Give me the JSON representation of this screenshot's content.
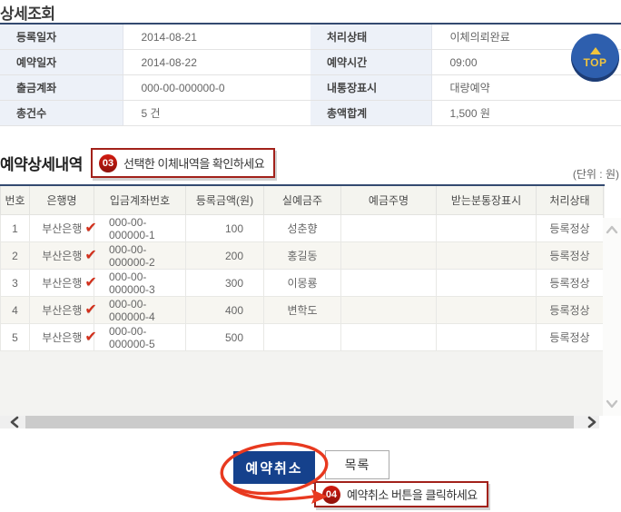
{
  "page": {
    "title": "상세조회",
    "section_title": "예약상세내역",
    "unit_note": "(단위 : 원)"
  },
  "top_button": {
    "label": "TOP"
  },
  "summary": {
    "rows": [
      {
        "label1": "등록일자",
        "value1": "2014-08-21",
        "label2": "처리상태",
        "value2": "이체의뢰완료"
      },
      {
        "label1": "예약일자",
        "value1": "2014-08-22",
        "label2": "예약시간",
        "value2": "09:00"
      },
      {
        "label1": "출금계좌",
        "value1": "000-00-000000-0",
        "label2": "내통장표시",
        "value2": "대량예약"
      },
      {
        "label1": "총건수",
        "value1": "5 건",
        "label2": "총액합계",
        "value2": "1,500 원"
      }
    ]
  },
  "callouts": {
    "step3": {
      "num": "03",
      "msg": "선택한 이체내역을 확인하세요"
    },
    "step4": {
      "num": "04",
      "msg": "예약취소 버튼을 클릭하세요"
    }
  },
  "detail_table": {
    "headers": [
      "번호",
      "은행명",
      "입금계좌번호",
      "등록금액(원)",
      "실예금주",
      "예금주명",
      "받는분통장표시",
      "처리상태"
    ],
    "check_icon": "✔",
    "rows": [
      {
        "no": "1",
        "bank": "부산은행",
        "account": "000-00-000000-1",
        "amount": "100",
        "holder": "성춘향",
        "depositor": "",
        "passbook": "",
        "status": "등록정상"
      },
      {
        "no": "2",
        "bank": "부산은행",
        "account": "000-00-000000-2",
        "amount": "200",
        "holder": "홍길동",
        "depositor": "",
        "passbook": "",
        "status": "등록정상"
      },
      {
        "no": "3",
        "bank": "부산은행",
        "account": "000-00-000000-3",
        "amount": "300",
        "holder": "이몽룡",
        "depositor": "",
        "passbook": "",
        "status": "등록정상"
      },
      {
        "no": "4",
        "bank": "부산은행",
        "account": "000-00-000000-4",
        "amount": "400",
        "holder": "변학도",
        "depositor": "",
        "passbook": "",
        "status": "등록정상"
      },
      {
        "no": "5",
        "bank": "부산은행",
        "account": "000-00-000000-5",
        "amount": "500",
        "holder": "",
        "depositor": "",
        "passbook": "",
        "status": "등록정상"
      }
    ]
  },
  "buttons": {
    "cancel_label": "예약취소",
    "list_label": "목록"
  },
  "colors": {
    "accent_navy": "#15418c",
    "callout_red": "#a2211a",
    "check_red": "#d2301c",
    "top_button_blue": "#2e5fae",
    "top_button_yellow": "#f0c43e"
  }
}
